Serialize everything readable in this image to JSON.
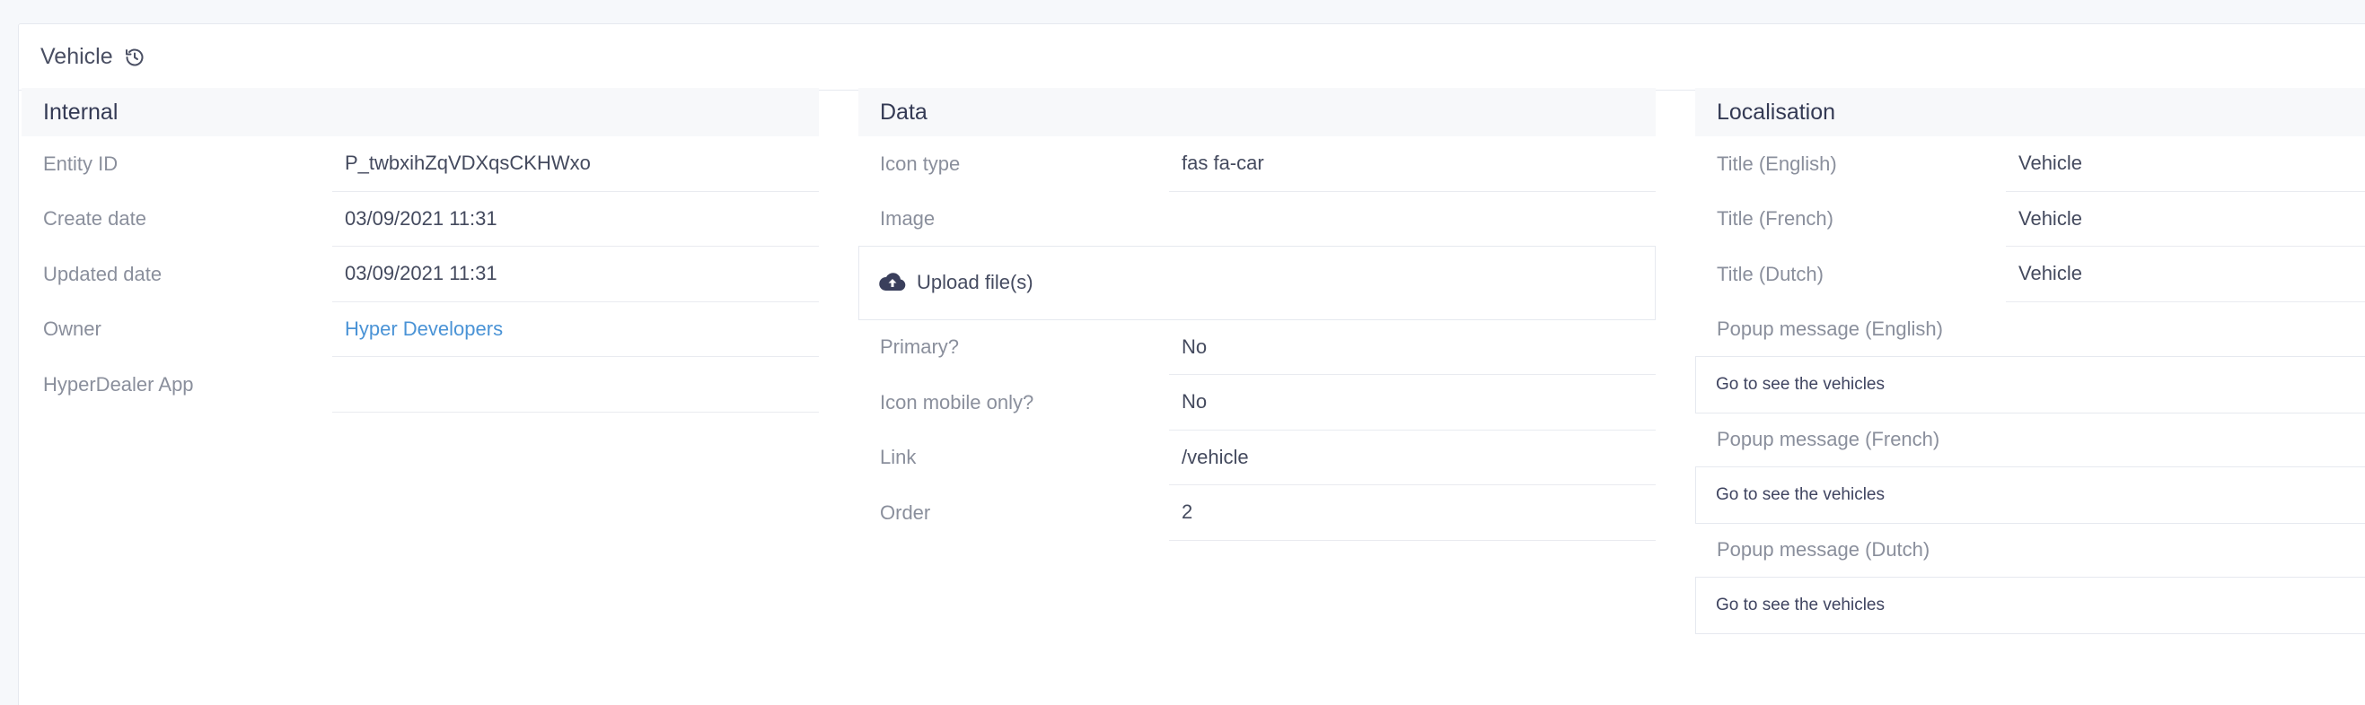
{
  "header": {
    "title": "Vehicle",
    "history_icon": "history-icon"
  },
  "internal": {
    "title": "Internal",
    "rows": [
      {
        "label": "Entity ID",
        "value": "P_twbxihZqVDXqsCKHWxo"
      },
      {
        "label": "Create date",
        "value": "03/09/2021 11:31"
      },
      {
        "label": "Updated date",
        "value": "03/09/2021 11:31"
      },
      {
        "label": "Owner",
        "value": "Hyper Developers"
      },
      {
        "label": "HyperDealer App",
        "value": ""
      }
    ]
  },
  "data": {
    "title": "Data",
    "icon_type": {
      "label": "Icon type",
      "value": "fas fa-car"
    },
    "image": {
      "label": "Image",
      "upload_label": "Upload file(s)"
    },
    "rows": [
      {
        "label": "Primary?",
        "value": "No"
      },
      {
        "label": "Icon mobile only?",
        "value": "No"
      },
      {
        "label": "Link",
        "value": "/vehicle"
      },
      {
        "label": "Order",
        "value": "2"
      }
    ]
  },
  "localisation": {
    "title": "Localisation",
    "rows": [
      {
        "label": "Title (English)",
        "value": "Vehicle"
      },
      {
        "label": "Title (French)",
        "value": "Vehicle"
      },
      {
        "label": "Title (Dutch)",
        "value": "Vehicle"
      }
    ],
    "popups": [
      {
        "label": "Popup message (English)",
        "value": "Go to see the vehicles"
      },
      {
        "label": "Popup message (French)",
        "value": "Go to see the vehicles"
      },
      {
        "label": "Popup message (Dutch)",
        "value": "Go to see the vehicles"
      }
    ]
  },
  "colors": {
    "accent_link": "#4a93d6",
    "section_bg": "#f7f8fa",
    "border": "#e6e9ef"
  }
}
